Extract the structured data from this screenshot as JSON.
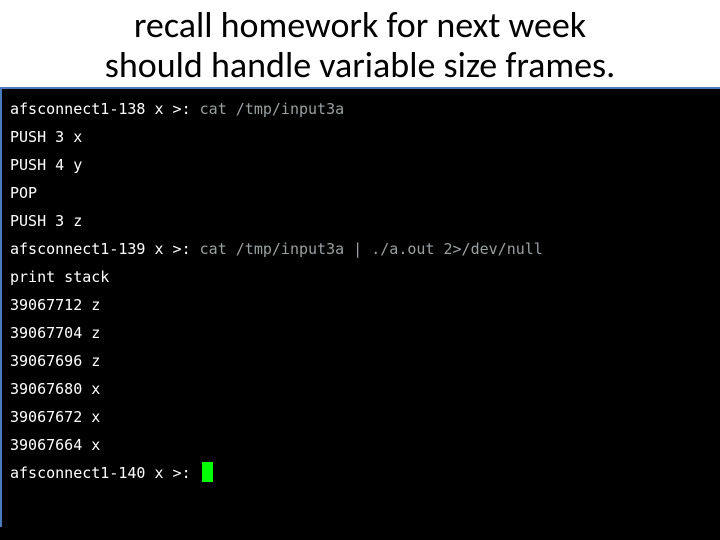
{
  "heading": {
    "line1": "recall homework for next week",
    "line2": "should handle variable size frames."
  },
  "terminal": {
    "prompt1": "afsconnect1-138 x >:",
    "cmd1": " cat /tmp/input3a",
    "out1": "PUSH 3 x",
    "out2": "PUSH 4 y",
    "out3": "POP",
    "out4": "PUSH 3 z",
    "prompt2": "afsconnect1-139 x >:",
    "cmd2": " cat /tmp/input3a | ./a.out 2>/dev/null",
    "out5": "print stack",
    "out6": "39067712 z",
    "out7": "39067704 z",
    "out8": "39067696 z",
    "out9": "39067680 x",
    "out10": "39067672 x",
    "out11": "39067664 x",
    "prompt3": "afsconnect1-140 x >:"
  }
}
